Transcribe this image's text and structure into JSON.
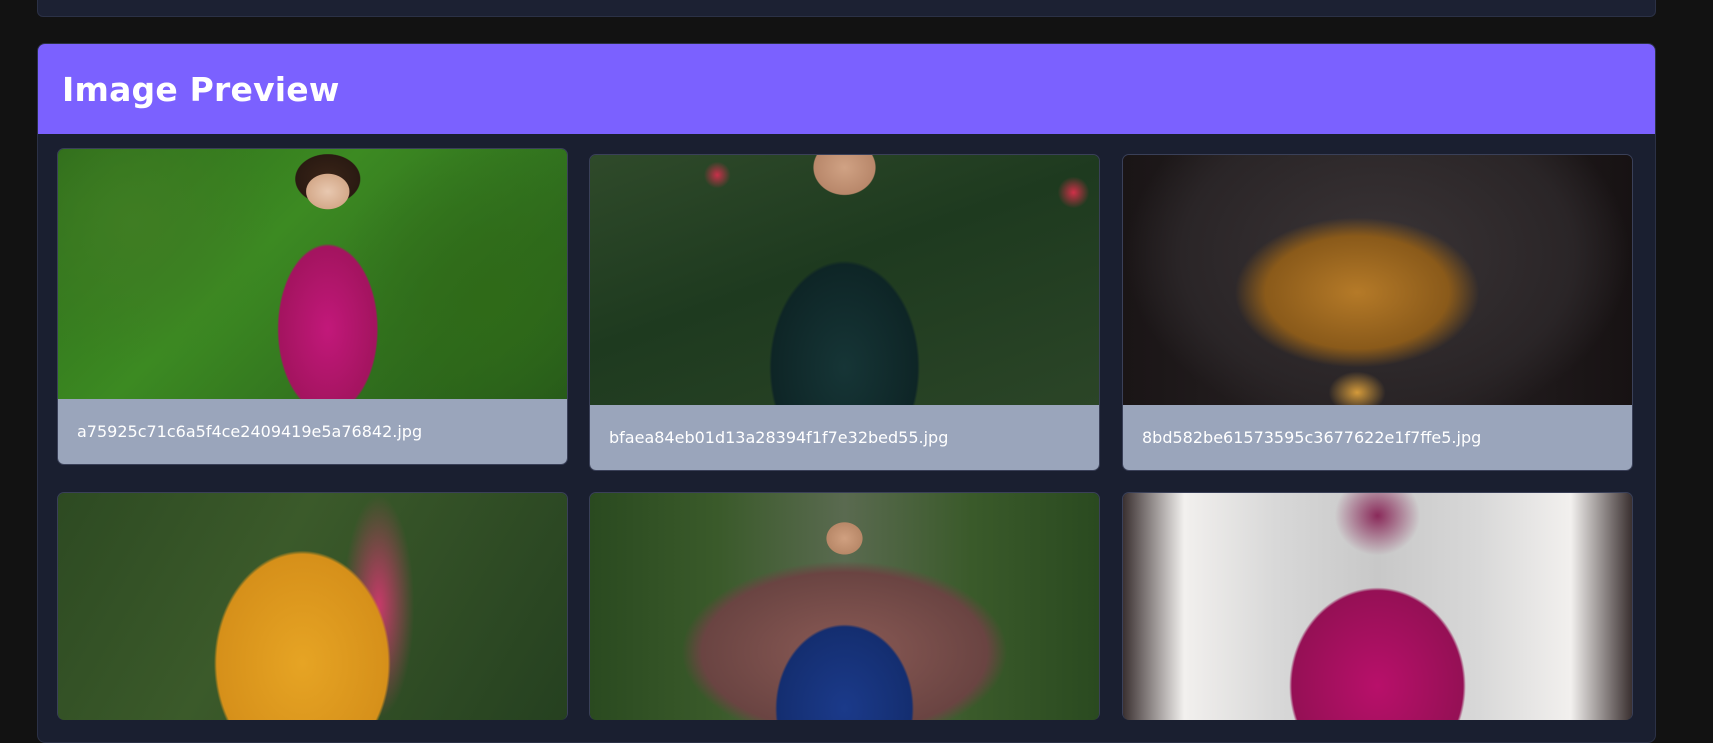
{
  "preview": {
    "title": "Image Preview"
  },
  "images": [
    {
      "filename": "a75925c71c6a5f4ce2409419e5a76842.jpg",
      "alt": "Woman in magenta lehenga against green hedge"
    },
    {
      "filename": "bfaea84eb01d13a28394f1f7e32bed55.jpg",
      "alt": "Dark teal sequined skirt in front of foliage"
    },
    {
      "filename": "8bd582be61573595c3677622e1f7ffe5.jpg",
      "alt": "Gold temple necklace on dark bust"
    },
    {
      "filename": "",
      "alt": "Woman in yellow lehenga in garden"
    },
    {
      "filename": "",
      "alt": "Woman in blue gown on garden path"
    },
    {
      "filename": "",
      "alt": "Woman in magenta gown in white corridor"
    }
  ],
  "colors": {
    "accent": "#7b61ff",
    "card_bg": "#1a1f30",
    "caption_bg": "#9aa5bb",
    "page_bg": "#121212"
  }
}
